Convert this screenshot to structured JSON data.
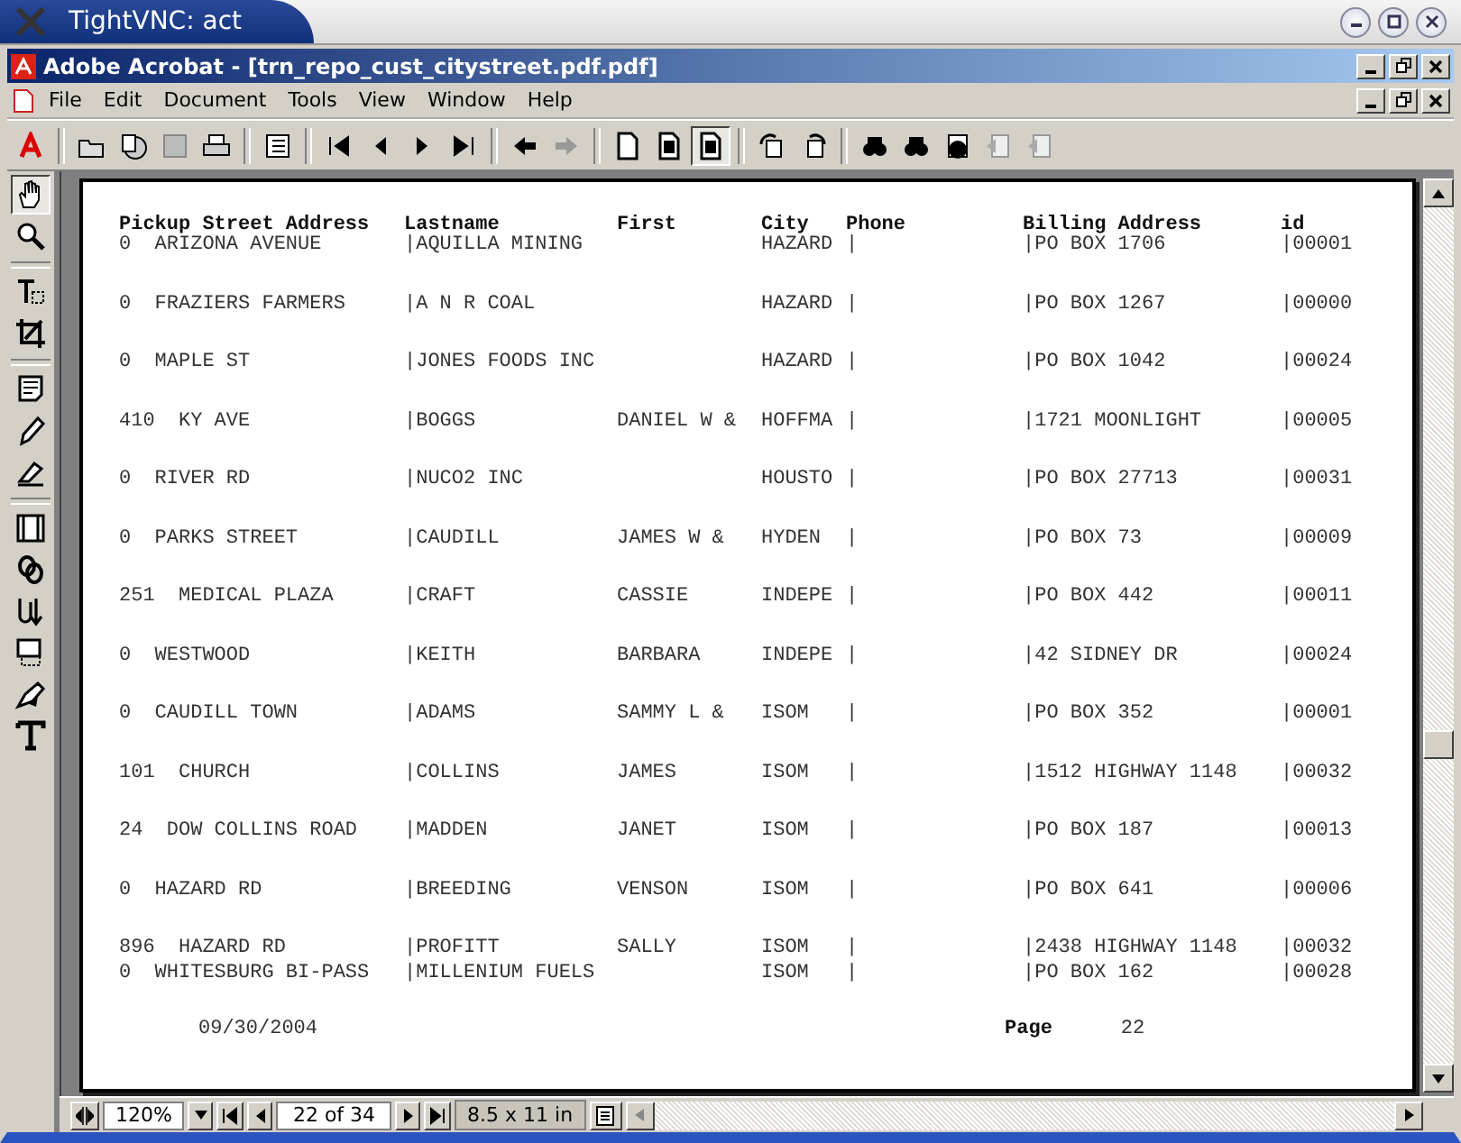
{
  "vnc_window": {
    "title": "TightVNC: act"
  },
  "app_window": {
    "title": "Adobe Acrobat - [trn_repo_cust_citystreet.pdf.pdf]"
  },
  "menu": [
    "File",
    "Edit",
    "Document",
    "Tools",
    "View",
    "Window",
    "Help"
  ],
  "report": {
    "columns": [
      "Pickup Street Address",
      "Lastname",
      "First",
      "City",
      "Phone",
      "Billing Address",
      "id"
    ],
    "rows": [
      [
        "0  ARIZONA AVENUE",
        "|AQUILLA MINING",
        "",
        "HAZARD",
        "|",
        "|PO BOX 1706",
        "|00001"
      ],
      [
        "0  FRAZIERS FARMERS",
        "|A N R COAL",
        "",
        "HAZARD",
        "|",
        "|PO BOX 1267",
        "|00000"
      ],
      [
        "0  MAPLE ST",
        "|JONES FOODS INC",
        "",
        "HAZARD",
        "|",
        "|PO BOX 1042",
        "|00024"
      ],
      [
        "410  KY AVE",
        "|BOGGS",
        "DANIEL W &",
        "HOFFMA",
        "|",
        "|1721 MOONLIGHT",
        "|00005"
      ],
      [
        "0  RIVER RD",
        "|NUCO2 INC",
        "",
        "HOUSTO",
        "|",
        "|PO BOX 27713",
        "|00031"
      ],
      [
        "0  PARKS STREET",
        "|CAUDILL",
        "JAMES W &",
        "HYDEN",
        "|",
        "|PO BOX 73",
        "|00009"
      ],
      [
        "251  MEDICAL PLAZA",
        "|CRAFT",
        "CASSIE",
        "INDEPE",
        "|",
        "|PO BOX 442",
        "|00011"
      ],
      [
        "0  WESTWOOD",
        "|KEITH",
        "BARBARA",
        "INDEPE",
        "|",
        "|42 SIDNEY DR",
        "|00024"
      ],
      [
        "0  CAUDILL TOWN",
        "|ADAMS",
        "SAMMY L &",
        "ISOM",
        "|",
        "|PO BOX 352",
        "|00001"
      ],
      [
        "101  CHURCH",
        "|COLLINS",
        "JAMES",
        "ISOM",
        "|",
        "|1512 HIGHWAY 1148",
        "|00032"
      ],
      [
        "24  DOW COLLINS ROAD",
        "|MADDEN",
        "JANET",
        "ISOM",
        "|",
        "|PO BOX 187",
        "|00013"
      ],
      [
        "0  HAZARD RD",
        "|BREEDING",
        "VENSON",
        "ISOM",
        "|",
        "|PO BOX 641",
        "|00006"
      ],
      [
        "896  HAZARD RD",
        "|PROFITT",
        "SALLY",
        "ISOM",
        "|",
        "|2438 HIGHWAY 1148",
        "|00032"
      ],
      [
        "0  WHITESBURG BI-PASS",
        "|MILLENIUM FUELS",
        "",
        "ISOM",
        "|",
        "|PO BOX 162",
        "|00028"
      ]
    ],
    "footer_date": "09/30/2004",
    "footer_page_label": "Page",
    "footer_page_number": "22"
  },
  "status_bar": {
    "zoom": "120%",
    "page": "22 of 34",
    "page_size": "8.5 x 11 in"
  }
}
